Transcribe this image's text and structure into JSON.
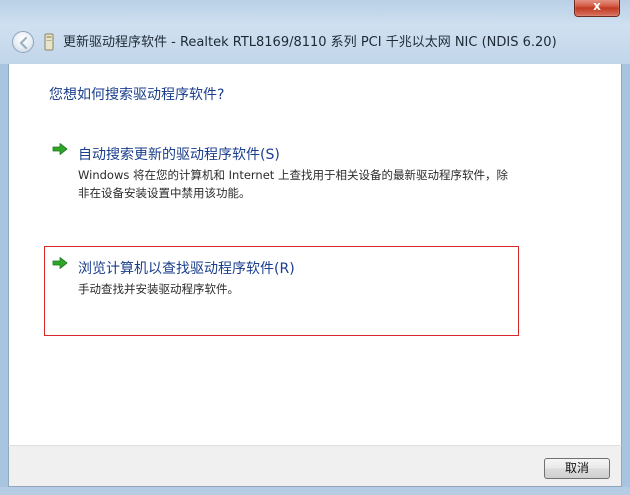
{
  "window": {
    "title": "更新驱动程序软件 - Realtek RTL8169/8110 系列 PCI 千兆以太网 NIC (NDIS 6.20)",
    "close_label": "x"
  },
  "main": {
    "heading": "您想如何搜索驱动程序软件?",
    "options": [
      {
        "title": "自动搜索更新的驱动程序软件(S)",
        "description": "Windows 将在您的计算机和 Internet 上查找用于相关设备的最新驱动程序软件，除非在设备安装设置中禁用该功能。",
        "icon": "green-arrow-icon"
      },
      {
        "title": "浏览计算机以查找驱动程序软件(R)",
        "description": "手动查找并安装驱动程序软件。",
        "icon": "green-arrow-icon"
      }
    ]
  },
  "footer": {
    "cancel_label": "取消"
  },
  "colors": {
    "link_blue": "#1a3e8c",
    "highlight_border": "#d9282b",
    "arrow_green": "#2fa52a"
  }
}
